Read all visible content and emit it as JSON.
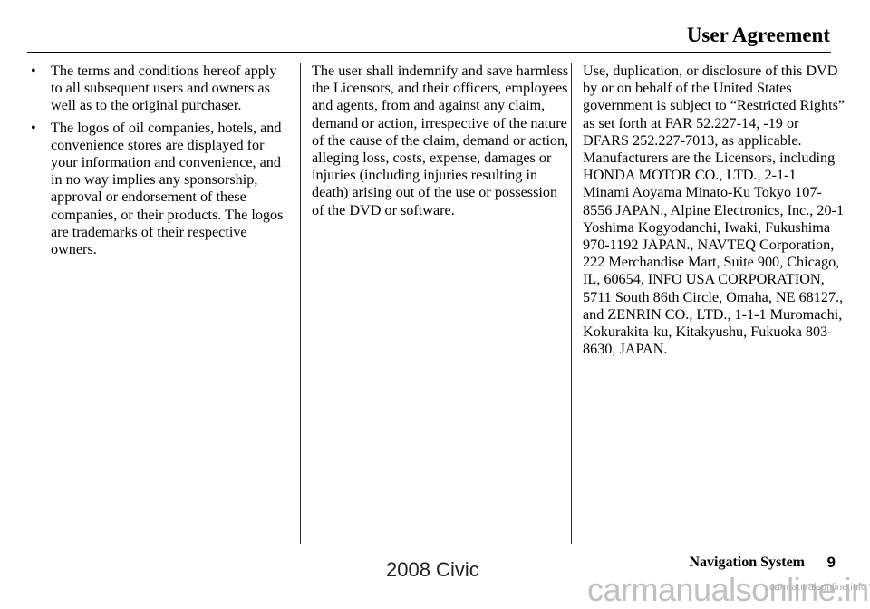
{
  "header": {
    "title": "User Agreement"
  },
  "column1": {
    "bullets": [
      {
        "symbol": "•",
        "text": "The terms and conditions hereof apply to all subsequent users and owners as well as to the original purchaser."
      },
      {
        "symbol": "•",
        "text": "The logos of oil companies, hotels, and convenience stores are displayed for your information and convenience, and in no way implies any sponsorship, approval or endorsement of these companies, or their products. The logos are trademarks of their respective owners."
      }
    ]
  },
  "column2": {
    "text": "The user shall indemnify and save harmless the Licensors, and their officers, employees and agents, from and against any claim, demand or action, irrespective of the nature of the cause of the claim, demand or action, alleging loss, costs, expense, damages or injuries (including injuries resulting in death) arising out of the use or possession of the DVD or software."
  },
  "column3": {
    "text": "Use, duplication, or disclosure of this DVD by or on behalf of the United States government is subject to “Restricted Rights” as set forth at FAR 52.227-14, -19 or DFARS 252.227-7013, as applicable. Manufacturers are the Licensors, including HONDA MOTOR CO., LTD., 2-1-1 Minami Aoyama Minato-Ku Tokyo 107-8556 JAPAN., Alpine Electronics, Inc., 20-1 Yoshima Kogyodanchi, Iwaki, Fukushima 970-1192 JAPAN., NAVTEQ Corporation, 222 Merchandise Mart, Suite 900, Chicago, IL, 60654, INFO USA CORPORATION, 5711 South 86th Circle, Omaha, NE 68127., and ZENRIN CO., LTD., 1-1-1 Muromachi, Kokurakita-ku, Kitakyushu, Fukuoka 803-8630, JAPAN."
  },
  "footer": {
    "section": "Navigation System",
    "page_number": "9",
    "model": "2008  Civic",
    "watermark": "carmanualsonline.info",
    "watermark_small": "carmanualsonline.info"
  }
}
